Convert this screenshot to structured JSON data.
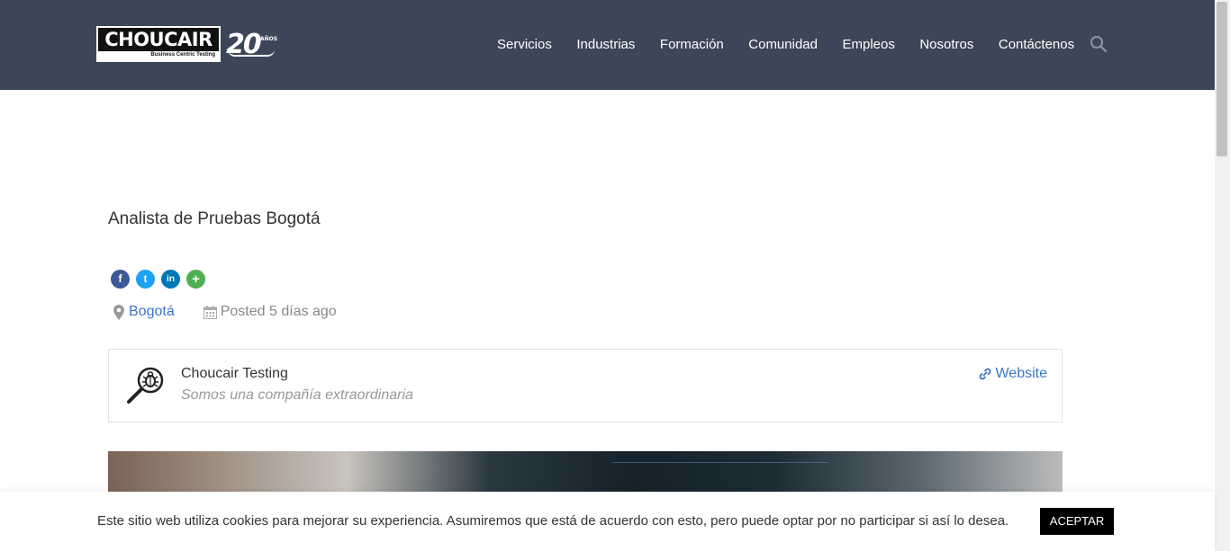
{
  "header": {
    "logo": {
      "brand": "CHOUCAIR",
      "tagline": "Business Centric Testing",
      "anniversary": "20",
      "years_label": "AÑOS"
    },
    "nav": [
      "Servicios",
      "Industrias",
      "Formación",
      "Comunidad",
      "Empleos",
      "Nosotros",
      "Contáctenos"
    ],
    "search_icon": "search-icon"
  },
  "job": {
    "title": "Analista de Pruebas Bogotá",
    "share": [
      {
        "name": "facebook",
        "glyph": "f",
        "color": "#3b5998"
      },
      {
        "name": "twitter",
        "glyph": "t",
        "color": "#1da1f2"
      },
      {
        "name": "linkedin",
        "glyph": "in",
        "color": "#0077b5"
      },
      {
        "name": "more",
        "glyph": "+",
        "color": "#4caf50"
      }
    ],
    "location": "Bogotá",
    "posted": "Posted 5 días ago"
  },
  "company": {
    "name": "Choucair Testing",
    "tagline": "Somos una compañía extraordinaria",
    "website_label": "Website"
  },
  "cookie": {
    "message": "Este sitio web utiliza cookies para mejorar su experiencia. Asumiremos que está de acuerdo con esto, pero puede optar por no participar si así lo desea.",
    "accept_label": "ACEPTAR"
  },
  "colors": {
    "header_bg": "#3b4659",
    "link": "#3d75c6"
  }
}
